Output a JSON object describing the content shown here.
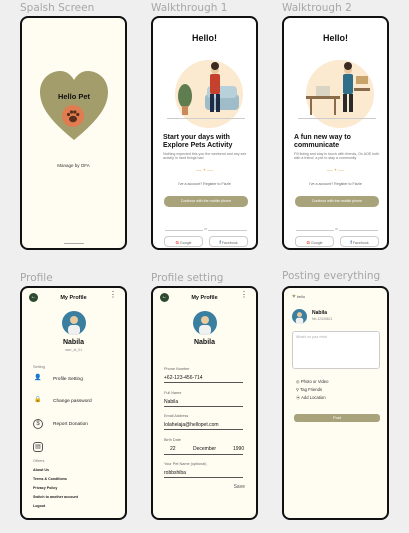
{
  "labels": {
    "splash": "Spalsh Screen",
    "walk1": "Walkthrough 1",
    "walk2": "Walktrough 2",
    "profile": "Profile",
    "profile_setting": "Profile setting",
    "posting": "Posting everything"
  },
  "splash": {
    "heart_title": "Hello Pet",
    "caption": "Manage by OFA"
  },
  "walk1": {
    "hello": "Hello!",
    "title": "Start your days with Explore Pets Activity",
    "desc": "Nothing expected this you the weekend and any see activity in hard things bad",
    "dots": "— • —",
    "link": "I've a account? Register to Fizzle",
    "btn": "Continue with the mobile phone",
    "or": "or",
    "google": "Google",
    "facebook": "Facebook"
  },
  "walk2": {
    "hello": "Hello!",
    "title": "A fun new way to communicate",
    "desc": "Fill listing and stay in touch with friends, On AOE both with a friend, a pet to stay a community",
    "dots": "— • —",
    "link": "I've a account? Register to Fizzle",
    "btn": "Continue with the mobile phone",
    "or": "or",
    "google": "Google",
    "facebook": "Facebook"
  },
  "profile": {
    "title": "My Profile",
    "name": "Nabila",
    "sub": "user_id_01",
    "setting_label": "Setting",
    "menu": [
      {
        "label": "Profile Setting",
        "icon": "user-icon"
      },
      {
        "label": "Change password",
        "icon": "lock-icon"
      },
      {
        "label": "Report Donation",
        "icon": "dollar-icon"
      },
      {
        "label": "",
        "icon": "notification-icon"
      }
    ],
    "others_label": "Others",
    "links": [
      "About Us",
      "Terms & Conditions",
      "Privacy Policy",
      "Switch to another account",
      "Logout"
    ]
  },
  "settings": {
    "title": "My Profile",
    "name": "Nabila",
    "phone_label": "Phone Number",
    "phone": "+62-123-456-714",
    "fullname_label": "Full Name",
    "fullname": "Nabila",
    "email_label": "Email Address",
    "email": "lolahelaja@hellopet.com",
    "birth_label": "Birth Date",
    "birth_day": "22",
    "birth_month": "December",
    "birth_year": "1990",
    "petname_label": "Your Pet Name (optional)",
    "petname": "robbshiba",
    "save": "Save"
  },
  "posting": {
    "logo": "hello",
    "name": "Nabila",
    "sub": "Nb.12345621",
    "placeholder": "What's on your mind",
    "options": [
      "Photo or Video",
      "Tag Friends",
      "Add Location"
    ],
    "post_btn": "Post"
  },
  "colors": {
    "olive": "#a8a37a",
    "heart": "#a39d6c",
    "paw": "#e07c4f",
    "dots": "#e2b766",
    "cream": "#fffdf2"
  }
}
